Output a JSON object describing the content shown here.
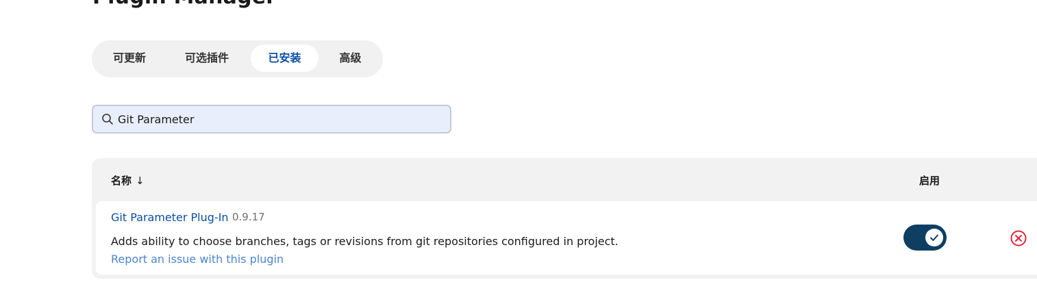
{
  "page_title": "Plugin Manager",
  "tabs": [
    {
      "label": "可更新",
      "active": false
    },
    {
      "label": "可选插件",
      "active": false
    },
    {
      "label": "已安装",
      "active": true
    },
    {
      "label": "高级",
      "active": false
    }
  ],
  "search": {
    "value": "Git Parameter",
    "icon": "search-icon"
  },
  "table": {
    "columns": {
      "name": "名称",
      "sort_indicator": "↓",
      "enabled": "启用"
    },
    "rows": [
      {
        "name": "Git Parameter Plug-In",
        "version": "0.9.17",
        "description": "Adds ability to choose branches, tags or revisions from git repositories configured in project.",
        "report_link": "Report an issue with this plugin",
        "enabled": true
      }
    ]
  },
  "colors": {
    "accent": "#0a4ea3",
    "toggle_on": "#0e3f63",
    "danger": "#e0273c",
    "link_secondary": "#4a85cc"
  }
}
